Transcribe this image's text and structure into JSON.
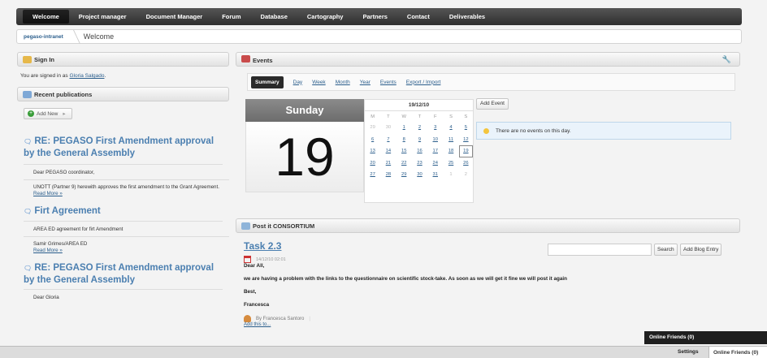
{
  "nav": [
    "Welcome",
    "Project manager",
    "Document Manager",
    "Forum",
    "Database",
    "Cartography",
    "Partners",
    "Contact",
    "Deliverables"
  ],
  "breadcrumb": {
    "root": "pegaso-intranet",
    "current": "Welcome"
  },
  "signin": {
    "title": "Sign In",
    "prefix": "You are signed in as",
    "user": "Gloria Salgado"
  },
  "recent": {
    "title": "Recent publications",
    "add_new": "Add New",
    "posts": [
      {
        "title": "RE: PEGASO First Amendment approval by the General Assembly",
        "lines": [
          "Dear PEGASO coordinator,",
          "UNOTT (Partner 9) herewith approves the first amendment to the Grant Agreement."
        ],
        "more": "Read More »"
      },
      {
        "title": "Firt Agreement",
        "lines": [
          "AREA ED agreement for firt Amendment",
          "Samir Grimes/AREA ED"
        ],
        "more": "Read More »"
      },
      {
        "title": "RE: PEGASO First Amendment approval by the General Assembly",
        "lines": [
          "Dear Gloria"
        ],
        "more": ""
      }
    ]
  },
  "events": {
    "title": "Events",
    "tabs": [
      "Summary",
      "Day",
      "Week",
      "Month",
      "Year",
      "Events",
      "Export / Import"
    ],
    "day_name": "Sunday",
    "day_number": "19",
    "cal_title": "19/12/10",
    "dow": [
      "M",
      "T",
      "W",
      "T",
      "F",
      "S",
      "S"
    ],
    "weeks": [
      [
        "29",
        "30",
        "1",
        "2",
        "3",
        "4",
        "5"
      ],
      [
        "6",
        "7",
        "8",
        "9",
        "10",
        "11",
        "12"
      ],
      [
        "13",
        "14",
        "15",
        "16",
        "17",
        "18",
        "19"
      ],
      [
        "20",
        "21",
        "22",
        "23",
        "24",
        "25",
        "26"
      ],
      [
        "27",
        "28",
        "29",
        "30",
        "31",
        "1",
        "2"
      ]
    ],
    "add_event": "Add Event",
    "no_events": "There are no events on this day."
  },
  "postit": {
    "title": "Post it CONSORTIUM",
    "task_title": "Task 2.3",
    "date": "14/12/10 02:01",
    "greeting": "Dear All,",
    "body": "we are having a problem with the links to the questionnaire on scientific stock-take. As soon as we will get it fine we will post it again",
    "closing": "Best,",
    "signature": "Francesca",
    "byline": "By Francesca Santoro",
    "add_this": "Add this to...",
    "search_label": "Search",
    "add_blog_label": "Add Blog Entry"
  },
  "chat": {
    "panel_title": "Online Friends (0)",
    "settings": "Settings",
    "online_tab": "Online Friends (0)"
  }
}
